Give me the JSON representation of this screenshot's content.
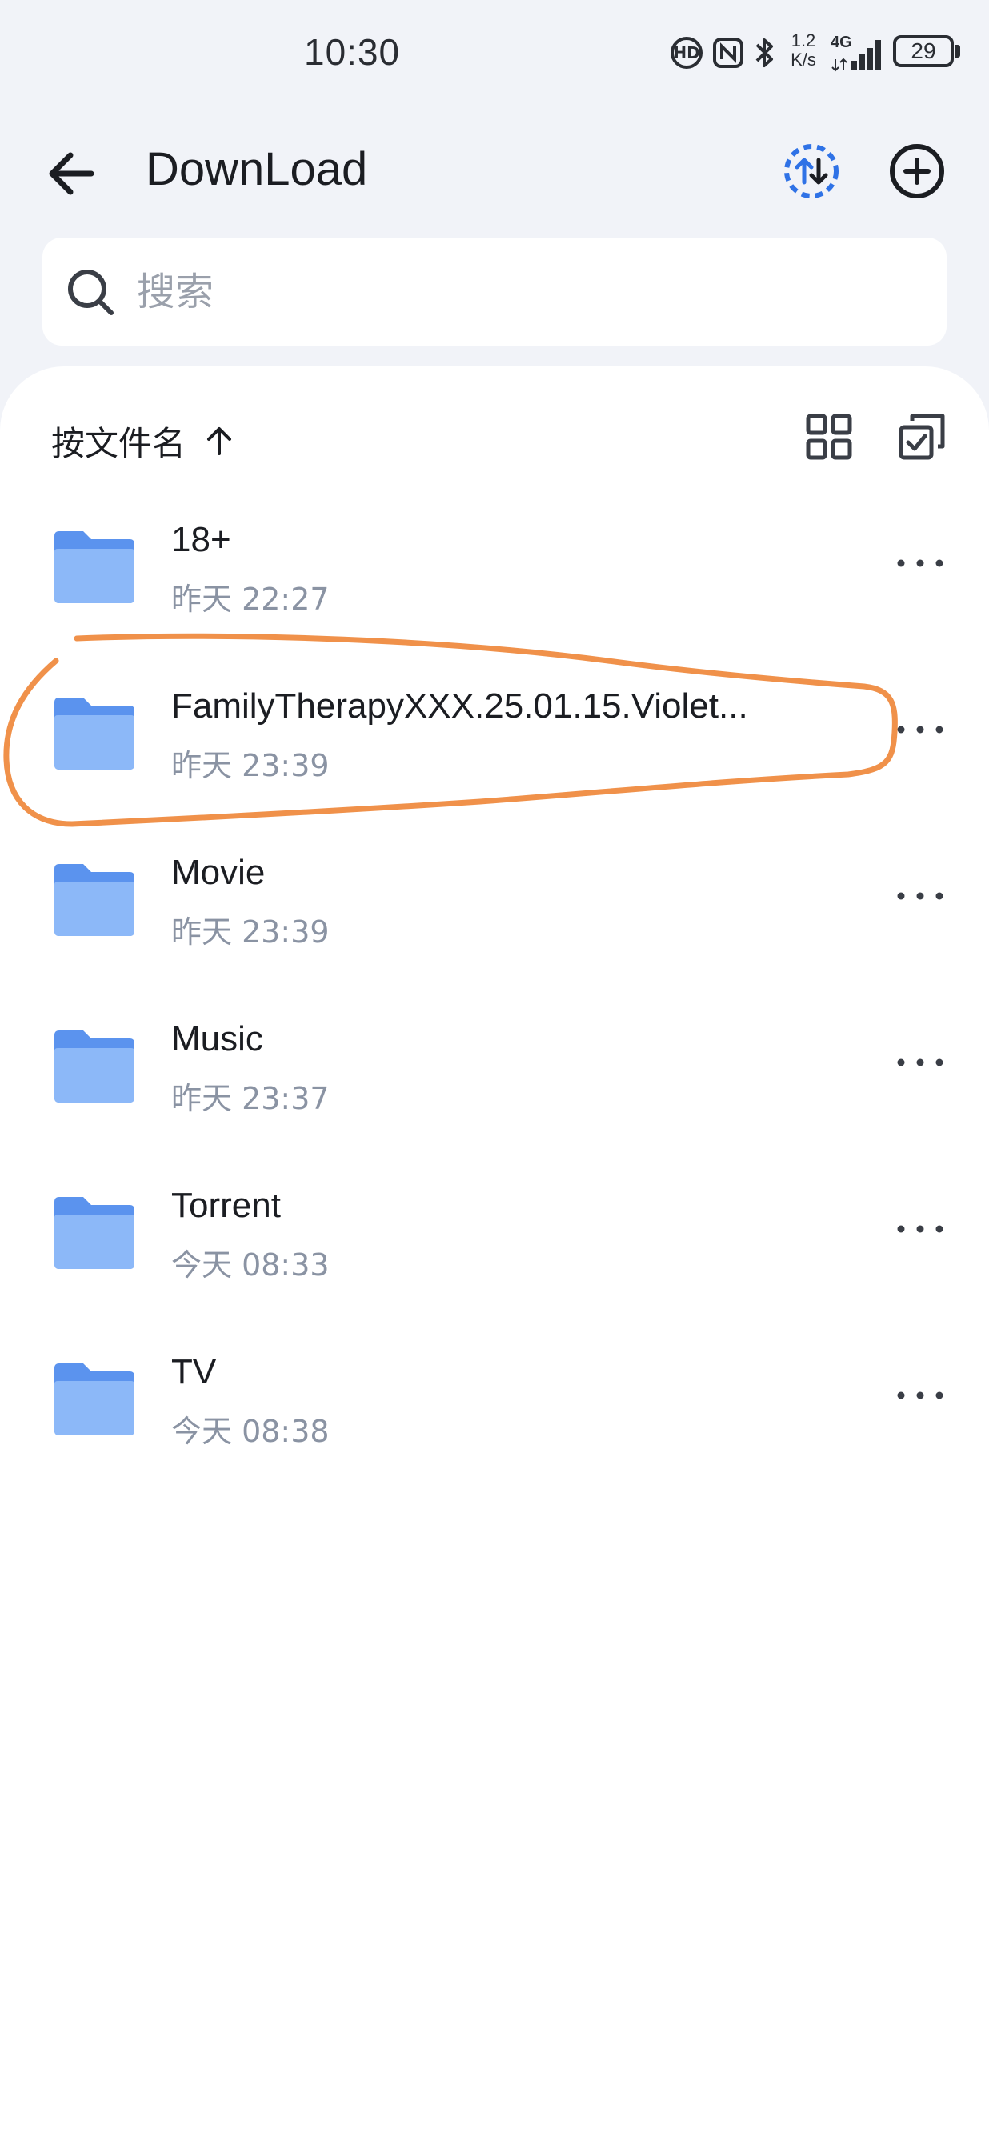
{
  "status_bar": {
    "time": "10:30",
    "net_speed_value": "1.2",
    "net_speed_unit": "K/s",
    "network_type": "4G",
    "battery": "29"
  },
  "header": {
    "title": "DownLoad",
    "back_icon": "back-arrow-icon",
    "transfer_icon": "transfer-icon",
    "add_icon": "add-circle-icon"
  },
  "search": {
    "placeholder": "搜索"
  },
  "toolbar": {
    "sort_label": "按文件名",
    "sort_icon": "arrow-up-icon",
    "grid_icon": "grid-view-icon",
    "multiselect_icon": "multi-select-icon"
  },
  "files": [
    {
      "name": "18+",
      "date": "昨天 22:27"
    },
    {
      "name": "FamilyTherapyXXX.25.01.15.Violet...",
      "date": "昨天 23:39"
    },
    {
      "name": "Movie",
      "date": "昨天 23:39"
    },
    {
      "name": "Music",
      "date": "昨天 23:37"
    },
    {
      "name": "Torrent",
      "date": "今天 08:33"
    },
    {
      "name": "TV",
      "date": "今天 08:38"
    }
  ],
  "colors": {
    "background": "#f1f3f8",
    "folder": "#7fb0f7",
    "folder_tab": "#5b93ee",
    "accent_blue": "#2f72e6",
    "annotation_orange": "#f0914a",
    "secondary_text": "#8a93a3"
  }
}
